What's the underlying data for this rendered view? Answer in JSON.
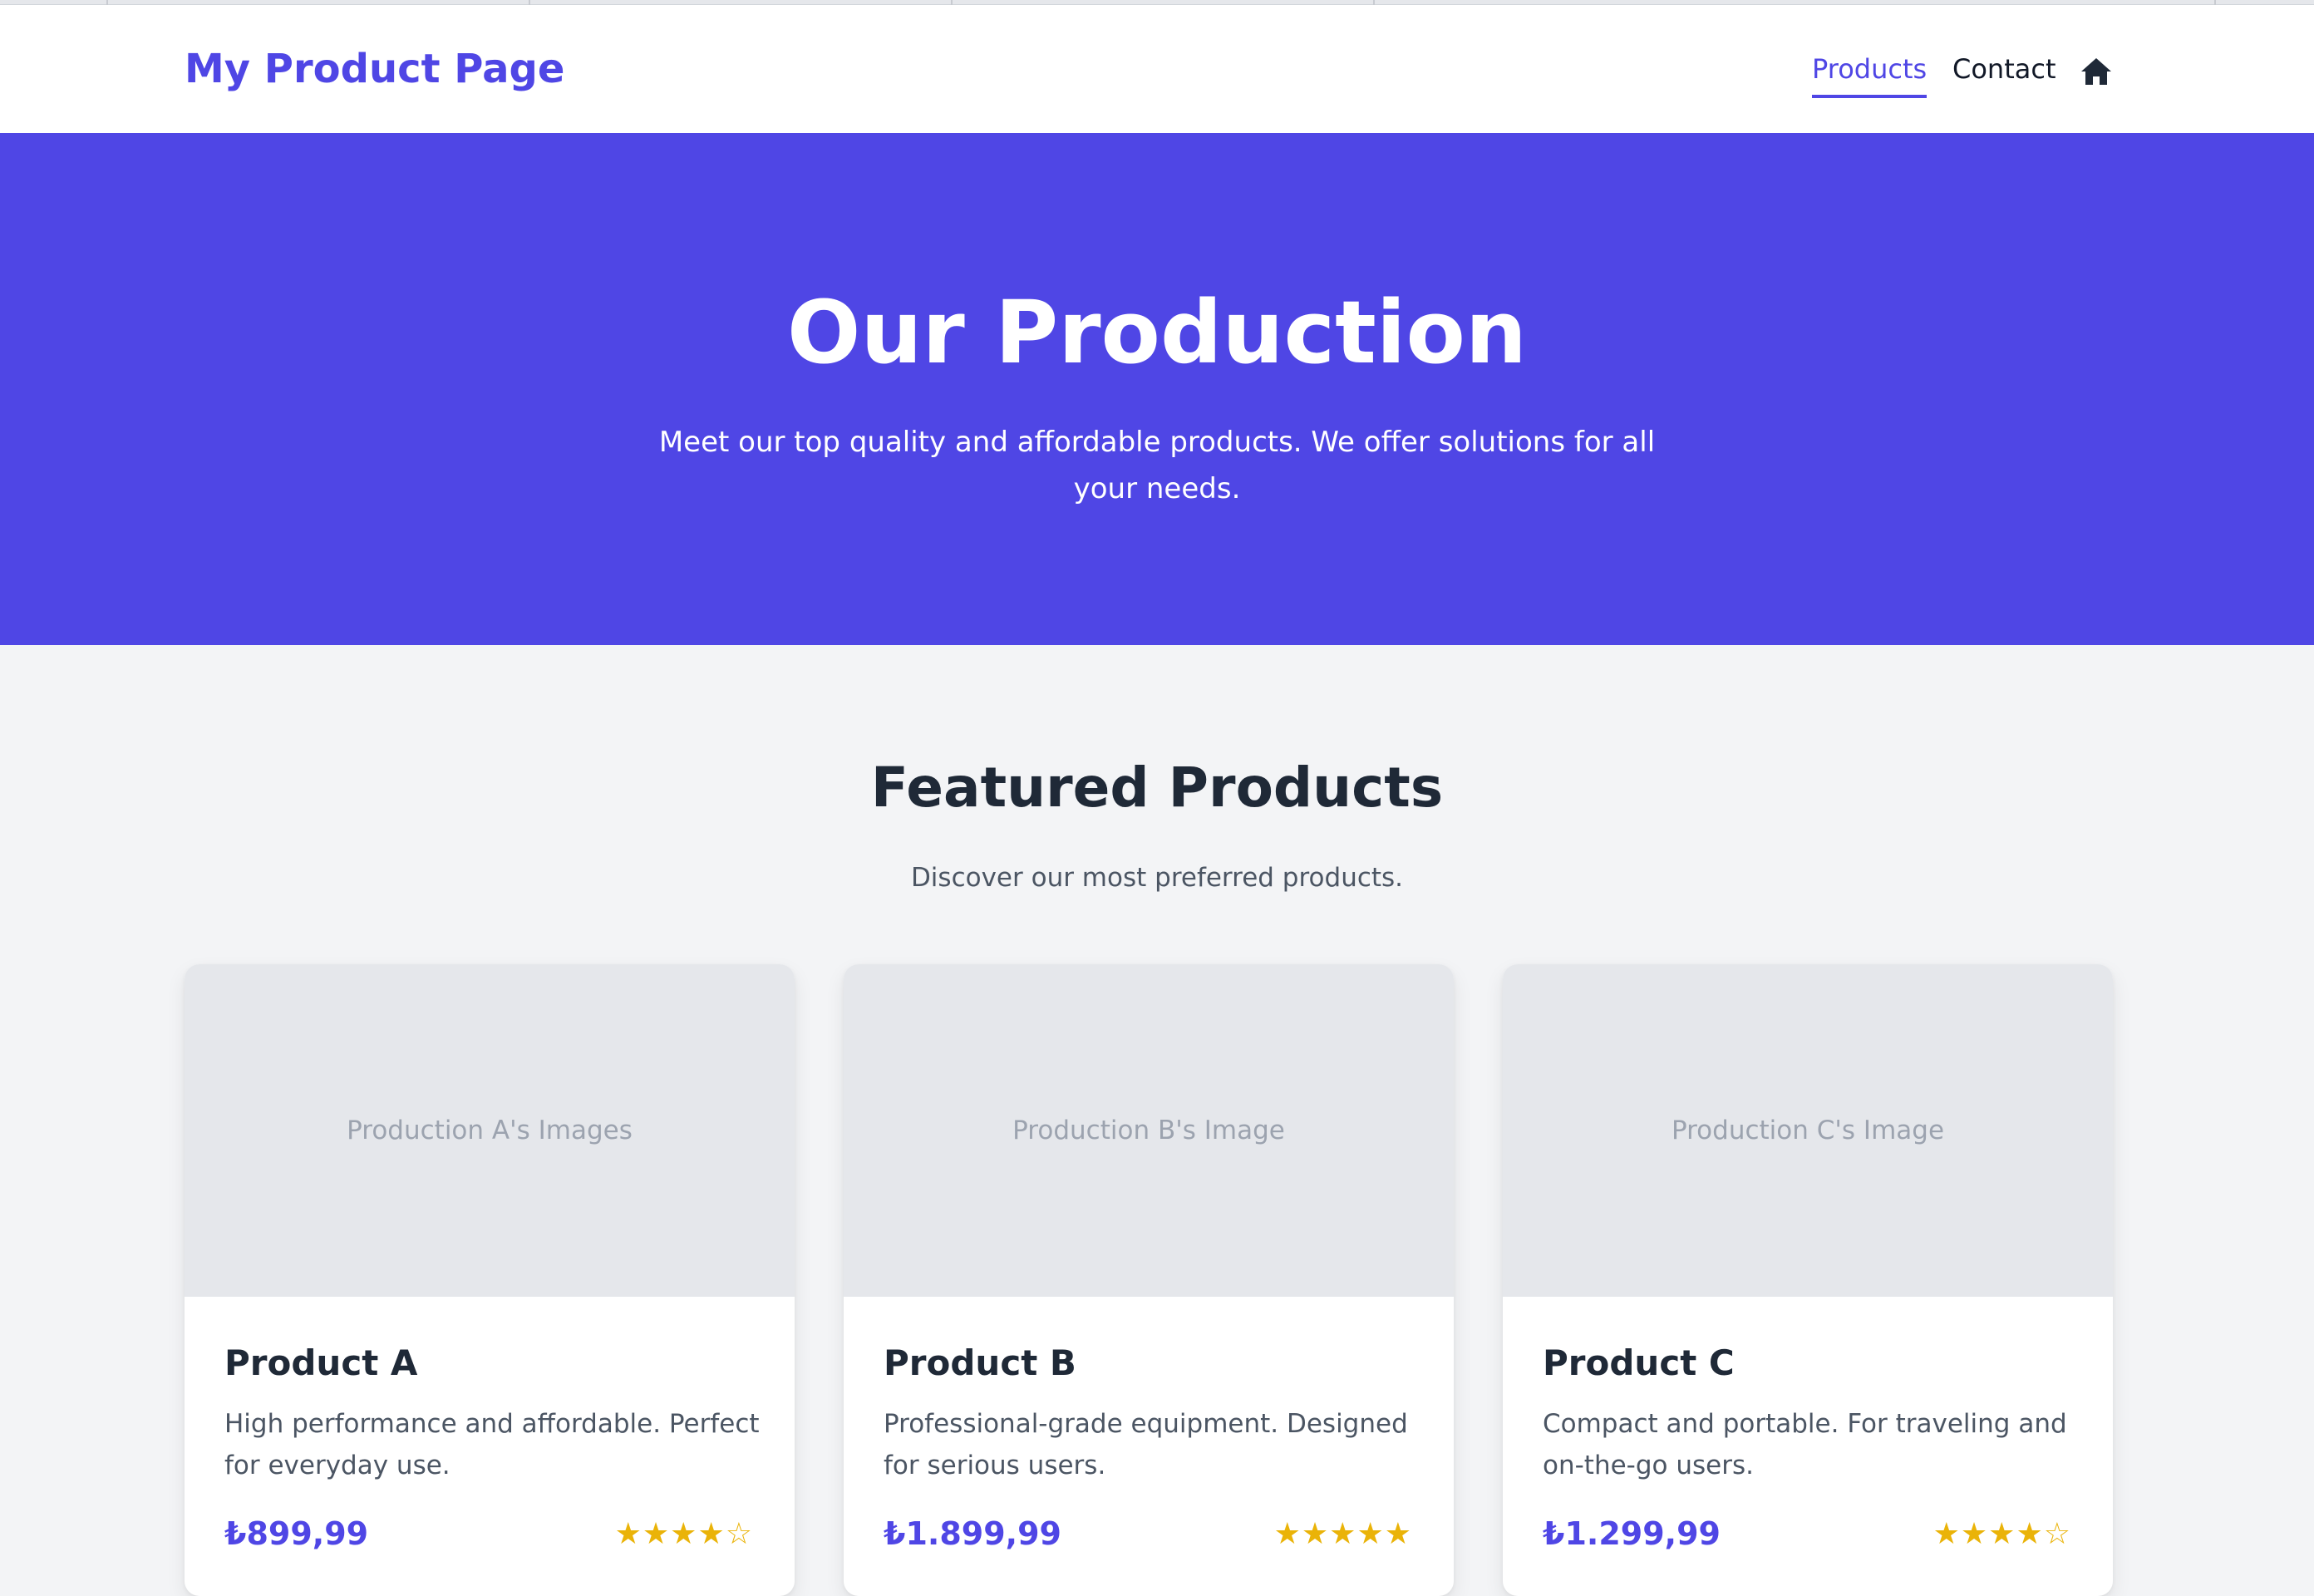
{
  "header": {
    "brand": "My Product Page",
    "nav": {
      "products": "Products",
      "contact": "Contact"
    },
    "accent_color": "#4f46e5"
  },
  "hero": {
    "title": "Our Production",
    "subtitle": "Meet our top quality and affordable products. We offer solutions for all your needs.",
    "background_color": "#4f46e5"
  },
  "featured": {
    "title": "Featured Products",
    "subtitle": "Discover our most preferred products."
  },
  "products": [
    {
      "image_placeholder": "Production A's Images",
      "name": "Product A",
      "description": "High performance and affordable. Perfect for everyday use.",
      "price": "₺899,99",
      "rating_stars": "★★★★☆",
      "rating": 4,
      "rating_max": 5
    },
    {
      "image_placeholder": "Production B's Image",
      "name": "Product B",
      "description": "Professional-grade equipment. Designed for serious users.",
      "price": "₺1.899,99",
      "rating_stars": "★★★★★",
      "rating": 5,
      "rating_max": 5
    },
    {
      "image_placeholder": "Production C's Image",
      "name": "Product C",
      "description": "Compact and portable. For traveling and on-the-go users.",
      "price": "₺1.299,99",
      "rating_stars": "★★★★☆",
      "rating": 4,
      "rating_max": 5
    }
  ],
  "icons": {
    "home": "home-icon",
    "star": "star-icon"
  }
}
